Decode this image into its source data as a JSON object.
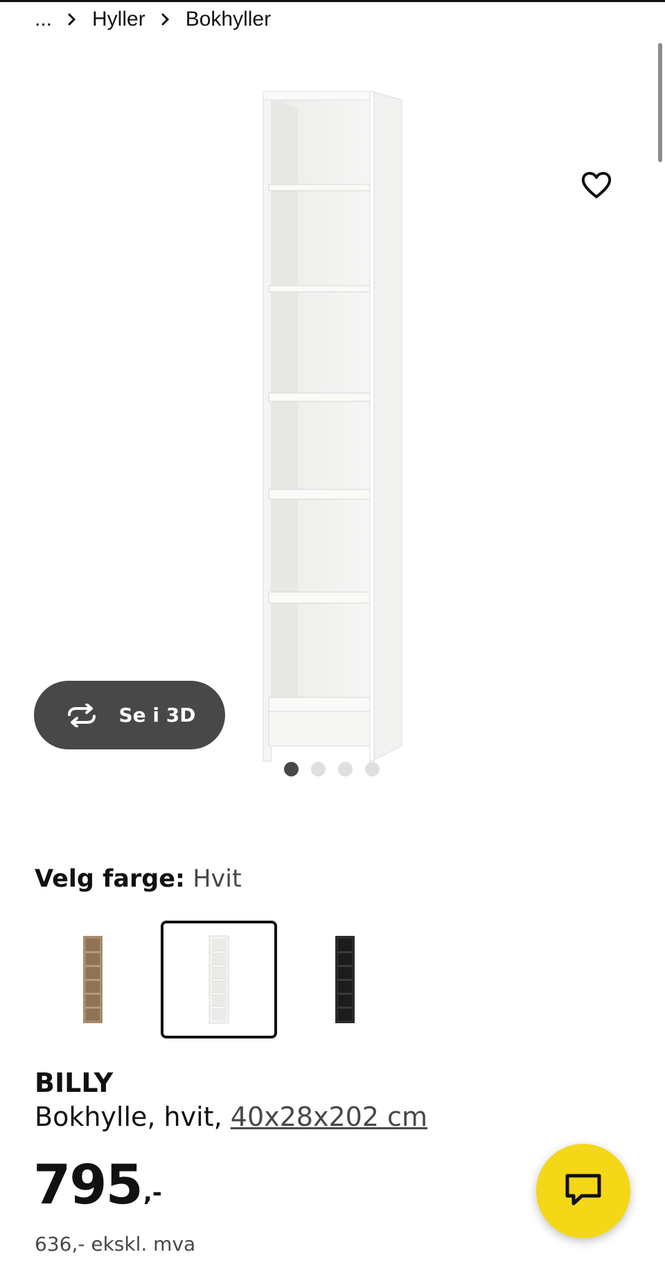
{
  "breadcrumb": {
    "ellipsis": "...",
    "items": [
      "Hyller",
      "Bokhyller"
    ]
  },
  "gallery": {
    "see_in_3d_label": "Se i 3D",
    "image_count": 4,
    "active_image_index": 0,
    "favorite_icon": "heart-outline-icon",
    "rotate_icon": "rotate-3d-icon"
  },
  "color_picker": {
    "label": "Velg farge:",
    "selected_value": "Hvit",
    "options": [
      {
        "name": "brown-walnut",
        "color": "#a98b6c",
        "selected": false
      },
      {
        "name": "white",
        "color": "#f4f3f1",
        "selected": true
      },
      {
        "name": "black-brown",
        "color": "#2b2b2b",
        "selected": false
      }
    ]
  },
  "product": {
    "name": "BILLY",
    "description": "Bokhylle, hvit,",
    "measurements": "40x28x202 cm",
    "price_integer": "795",
    "price_suffix": ",-",
    "price_excl_vat": "636,- ekskl. mva"
  },
  "chat": {
    "icon": "chat-bubble-icon",
    "color": "#f4d717"
  },
  "colors": {
    "dark_button": "#484848",
    "brand_yellow": "#f4d717",
    "text": "#111111"
  }
}
